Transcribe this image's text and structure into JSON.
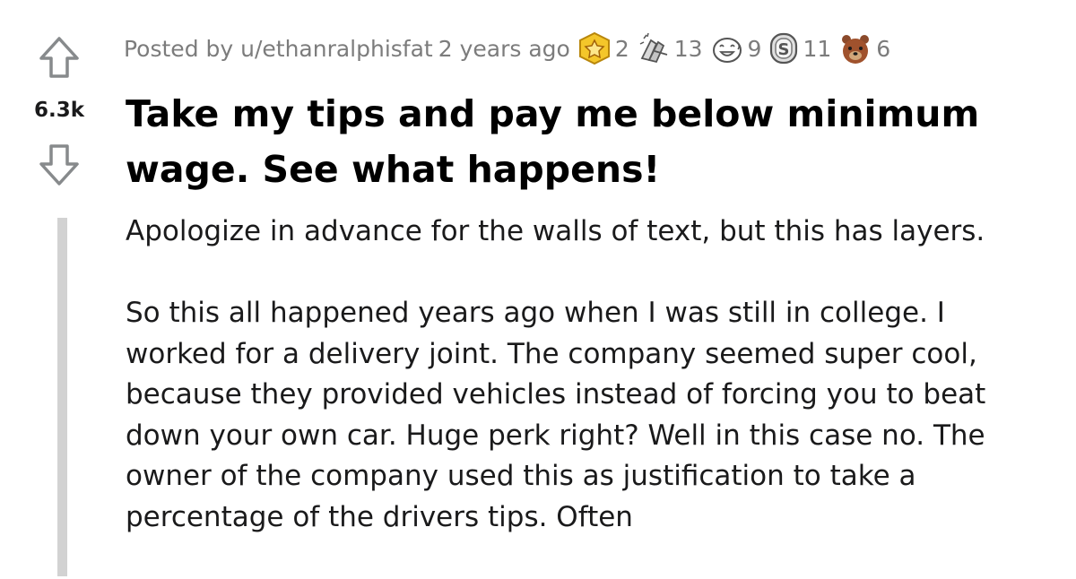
{
  "post": {
    "score": "6.3k",
    "posted_by": "Posted by u/ethanralphisfat",
    "time_ago": "2 years ago",
    "awards": [
      {
        "icon": "gold-badge-icon",
        "count": "2"
      },
      {
        "icon": "praise-hands-icon",
        "count": "13"
      },
      {
        "icon": "laughing-face-icon",
        "count": "9"
      },
      {
        "icon": "silver-coin-icon",
        "count": "11"
      },
      {
        "icon": "bear-icon",
        "count": "6"
      }
    ],
    "title": "Take my tips and pay me below minimum wage. See what happens!",
    "paragraphs": [
      "Apologize in advance for the walls of text, but this has layers.",
      "So this all happened years ago when I was still in college. I worked for a delivery joint. The company seemed super cool, because they provided vehicles instead of forcing you to beat down your own car. Huge perk right? Well in this case no. The owner of the company used this as justification to take a percentage of the drivers tips. Often"
    ]
  },
  "colors": {
    "meta_text": "#7c7c7c",
    "thread_line": "#d2d2d2",
    "vote_arrow": "#878a8c"
  }
}
